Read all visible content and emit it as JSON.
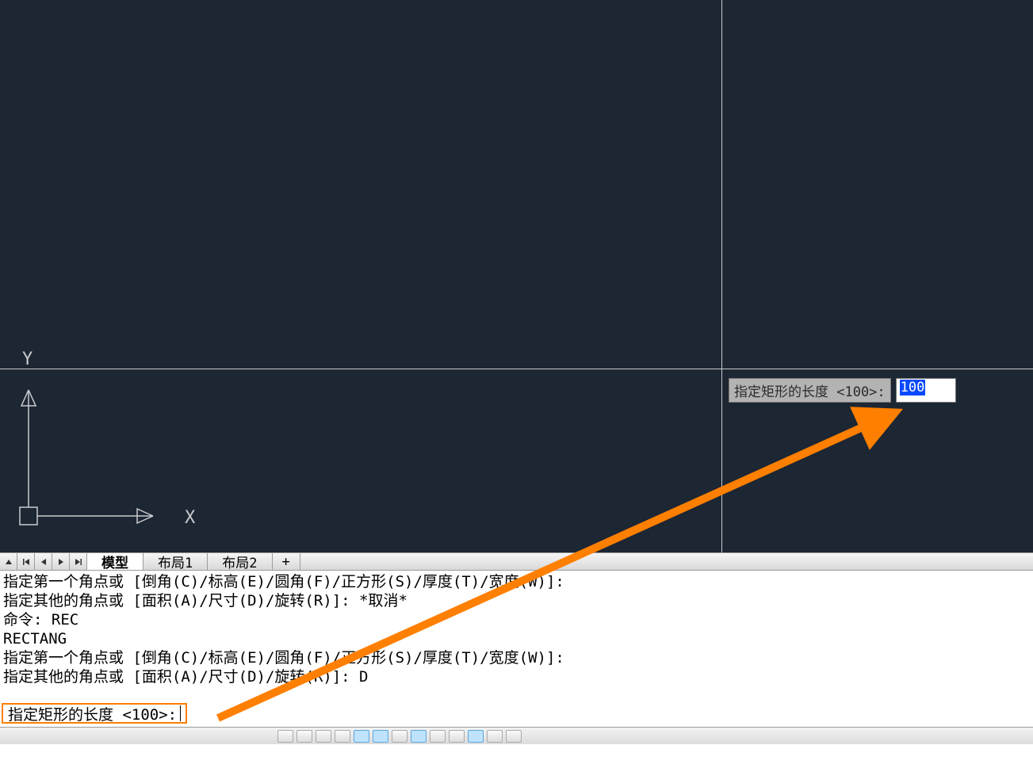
{
  "viewport": {
    "ucs_x_label": "X",
    "ucs_y_label": "Y"
  },
  "dynamic_input": {
    "prompt": "指定矩形的长度 <100>:",
    "value": "100"
  },
  "tabs": {
    "model": "模型",
    "layout1": "布局1",
    "layout2": "布局2",
    "add": "+"
  },
  "command_history": [
    "指定第一个角点或 [倒角(C)/标高(E)/圆角(F)/正方形(S)/厚度(T)/宽度(W)]:",
    "指定其他的角点或 [面积(A)/尺寸(D)/旋转(R)]: *取消*",
    "命令: REC",
    "RECTANG",
    "指定第一个角点或 [倒角(C)/标高(E)/圆角(F)/正方形(S)/厚度(T)/宽度(W)]:",
    "指定其他的角点或 [面积(A)/尺寸(D)/旋转(R)]: D"
  ],
  "command_prompt": "指定矩形的长度 <100>:",
  "annotation": {
    "color": "#ff7f00"
  }
}
